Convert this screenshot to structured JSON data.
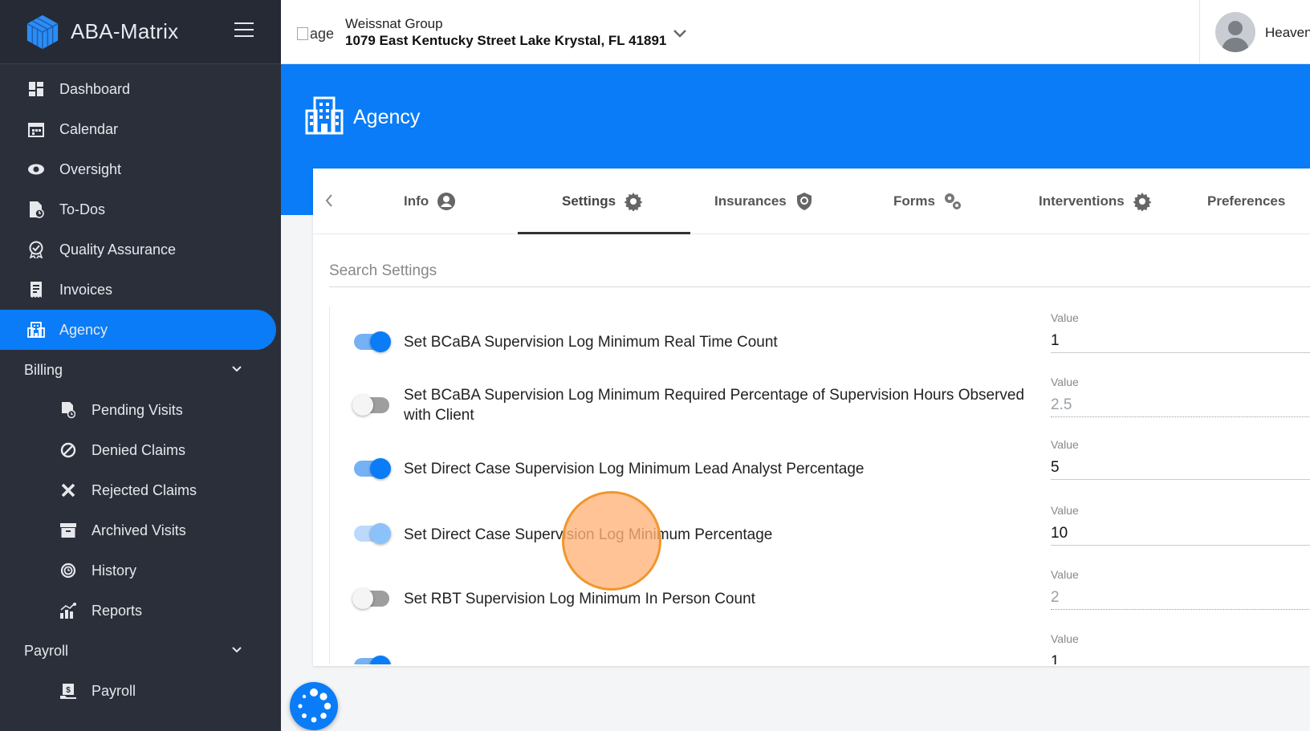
{
  "app": {
    "name": "ABA-Matrix"
  },
  "header": {
    "org_image_alt": "age",
    "org_name": "Weissnat Group",
    "org_address": "1079 East Kentucky Street Lake Krystal, FL 41891",
    "user_name": "Heaven"
  },
  "sidebar": {
    "items": [
      {
        "label": "Dashboard",
        "icon": "dashboard-icon"
      },
      {
        "label": "Calendar",
        "icon": "calendar-icon"
      },
      {
        "label": "Oversight",
        "icon": "eye-icon"
      },
      {
        "label": "To-Dos",
        "icon": "todo-icon"
      },
      {
        "label": "Quality Assurance",
        "icon": "badge-check-icon"
      },
      {
        "label": "Invoices",
        "icon": "invoice-icon"
      },
      {
        "label": "Agency",
        "icon": "building-icon",
        "active": true
      }
    ],
    "billing": {
      "label": "Billing",
      "items": [
        {
          "label": "Pending Visits",
          "icon": "pending-icon"
        },
        {
          "label": "Denied Claims",
          "icon": "ban-icon"
        },
        {
          "label": "Rejected Claims",
          "icon": "x-icon"
        },
        {
          "label": "Archived Visits",
          "icon": "archive-icon"
        },
        {
          "label": "History",
          "icon": "history-icon"
        },
        {
          "label": "Reports",
          "icon": "chart-icon"
        }
      ]
    },
    "payroll": {
      "label": "Payroll",
      "items": [
        {
          "label": "Payroll",
          "icon": "payroll-icon"
        }
      ]
    }
  },
  "page": {
    "title": "Agency"
  },
  "tabs": [
    {
      "label": "Info",
      "icon": "user-circle-icon"
    },
    {
      "label": "Settings",
      "icon": "gear-icon",
      "active": true
    },
    {
      "label": "Insurances",
      "icon": "shield-icon"
    },
    {
      "label": "Forms",
      "icon": "gears-icon"
    },
    {
      "label": "Interventions",
      "icon": "gear-icon"
    },
    {
      "label": "Preferences",
      "icon": ""
    }
  ],
  "search": {
    "placeholder": "Search Settings",
    "value": ""
  },
  "settings": [
    {
      "label": "Set BCaBA Supervision Log Minimum Real Time Count",
      "enabled": true,
      "value_caption": "Value",
      "value": "1"
    },
    {
      "label": "Set BCaBA Supervision Log Minimum Required Percentage of Supervision Hours Observed with Client",
      "enabled": false,
      "value_caption": "Value",
      "value": "2.5"
    },
    {
      "label": "Set Direct Case Supervision Log Minimum Lead Analyst Percentage",
      "enabled": true,
      "value_caption": "Value",
      "value": "5"
    },
    {
      "label": "Set Direct Case Supervision Log Minimum Percentage",
      "enabled": true,
      "value_caption": "Value",
      "value": "10"
    },
    {
      "label": "Set RBT Supervision Log Minimum In Person Count",
      "enabled": false,
      "value_caption": "Value",
      "value": "2"
    },
    {
      "label": "",
      "enabled": true,
      "value_caption": "Value",
      "value": "1"
    }
  ],
  "colors": {
    "primary": "#0a7cf7",
    "sidebar_bg": "#2b2f3a",
    "click_highlight": "#f0962e"
  }
}
